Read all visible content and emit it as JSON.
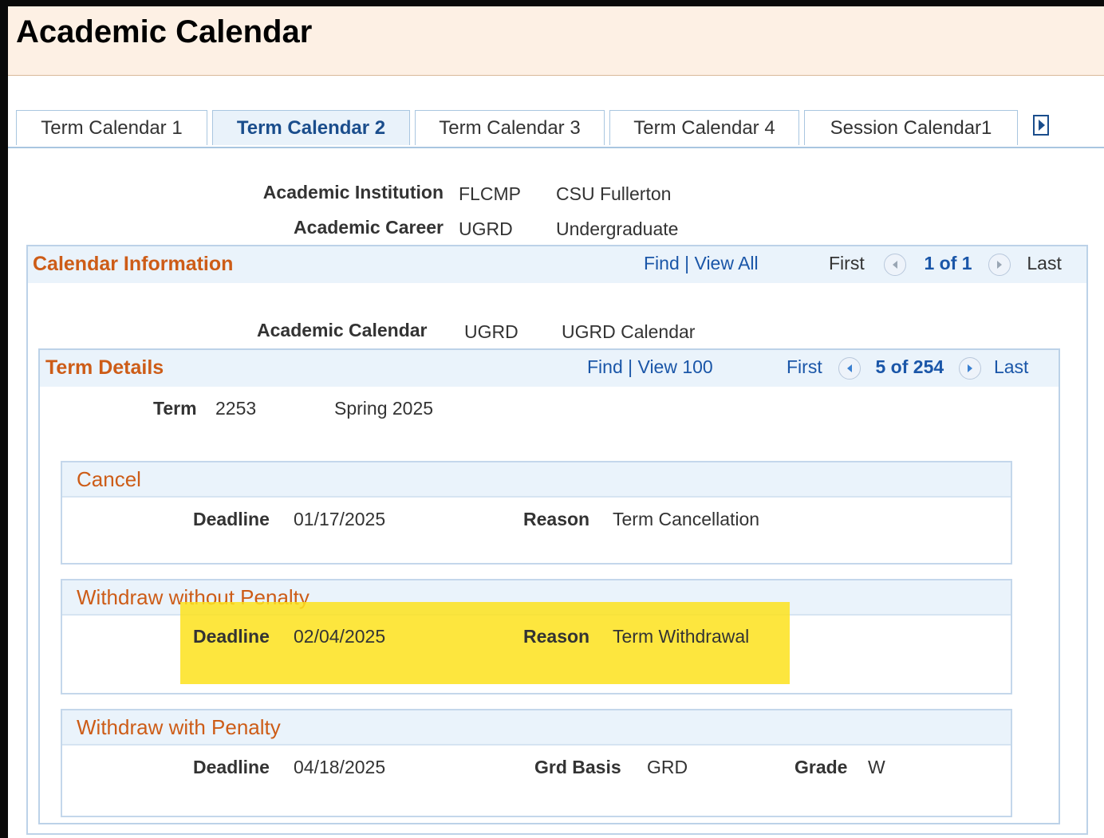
{
  "page": {
    "title": "Academic Calendar"
  },
  "tabs": [
    {
      "label": "Term Calendar 1",
      "active": false
    },
    {
      "label": "Term Calendar 2",
      "active": true
    },
    {
      "label": "Term Calendar 3",
      "active": false
    },
    {
      "label": "Term Calendar 4",
      "active": false
    },
    {
      "label": "Session Calendar1",
      "active": false
    }
  ],
  "tabs_next_icon": "arrow-right-icon",
  "institution": {
    "label": "Academic Institution",
    "code": "FLCMP",
    "name": "CSU Fullerton"
  },
  "career": {
    "label": "Academic Career",
    "code": "UGRD",
    "name": "Undergraduate"
  },
  "calendar_info": {
    "title": "Calendar Information",
    "find": "Find",
    "separator": "|",
    "view": "View All",
    "first": "First",
    "count": "1 of 1",
    "last": "Last",
    "academic_calendar_label": "Academic Calendar",
    "academic_calendar_code": "UGRD",
    "academic_calendar_name": "UGRD Calendar"
  },
  "term_details": {
    "title": "Term Details",
    "find": "Find",
    "separator": "|",
    "view": "View 100",
    "first": "First",
    "count": "5 of 254",
    "last": "Last",
    "term_label": "Term",
    "term_code": "2253",
    "term_name": "Spring 2025"
  },
  "sections": {
    "cancel": {
      "title": "Cancel",
      "deadline_label": "Deadline",
      "deadline": "01/17/2025",
      "reason_label": "Reason",
      "reason": "Term Cancellation"
    },
    "withdraw_no_penalty": {
      "title": "Withdraw without Penalty",
      "deadline_label": "Deadline",
      "deadline": "02/04/2025",
      "reason_label": "Reason",
      "reason": "Term Withdrawal"
    },
    "withdraw_penalty": {
      "title": "Withdraw with Penalty",
      "deadline_label": "Deadline",
      "deadline": "04/18/2025",
      "grd_basis_label": "Grd Basis",
      "grd_basis": "GRD",
      "grade_label": "Grade",
      "grade": "W"
    }
  },
  "colors": {
    "highlight": "#fde21c",
    "section_title": "#cd5c17",
    "link": "#1a56a8",
    "header_bg": "#fdf0e4"
  }
}
